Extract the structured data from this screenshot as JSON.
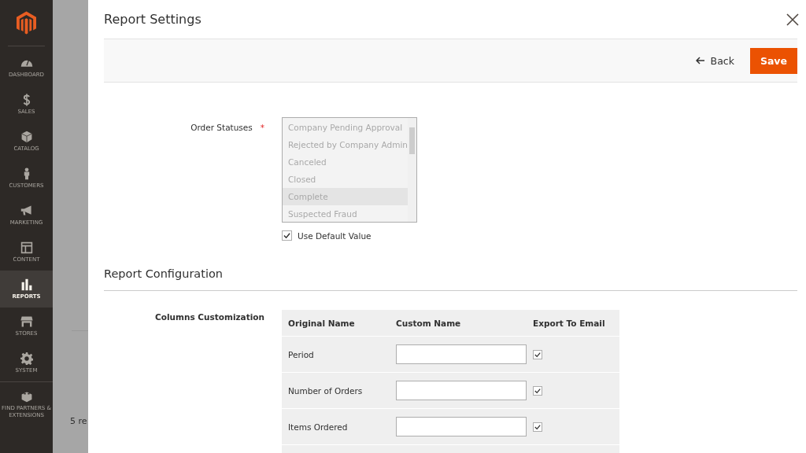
{
  "sidebar": {
    "items": [
      {
        "label": "DASHBOARD",
        "kind": "gauge",
        "selected": false
      },
      {
        "label": "SALES",
        "kind": "dollar",
        "selected": false
      },
      {
        "label": "CATALOG",
        "kind": "box",
        "selected": false
      },
      {
        "label": "CUSTOMERS",
        "kind": "person",
        "selected": false
      },
      {
        "label": "MARKETING",
        "kind": "megaphone",
        "selected": false
      },
      {
        "label": "CONTENT",
        "kind": "layout",
        "selected": false
      },
      {
        "label": "REPORTS",
        "kind": "bars",
        "selected": true
      },
      {
        "label": "STORES",
        "kind": "store",
        "selected": false
      },
      {
        "label": "SYSTEM",
        "kind": "gear",
        "selected": false
      },
      {
        "label": "FIND PARTNERS & EXTENSIONS",
        "kind": "brick",
        "selected": false
      }
    ]
  },
  "backdrop": {
    "text": "5 re"
  },
  "modal": {
    "title": "Report Settings",
    "back_button": "Back",
    "save_button": "Save",
    "order_statuses": {
      "label": "Order Statuses",
      "required_mark": "*",
      "disabled": true,
      "options": [
        {
          "label": "Company Pending Approval",
          "selected": false
        },
        {
          "label": "Rejected by Company Admin",
          "selected": false
        },
        {
          "label": "Canceled",
          "selected": false
        },
        {
          "label": "Closed",
          "selected": false
        },
        {
          "label": "Complete",
          "selected": true
        },
        {
          "label": "Suspected Fraud",
          "selected": false
        }
      ],
      "use_default": {
        "label": "Use Default Value",
        "checked": true
      }
    },
    "section_title": "Report Configuration",
    "columns_customization": {
      "label": "Columns Customization",
      "columns": [
        "Original Name",
        "Custom Name",
        "Export To Email"
      ],
      "rows": [
        {
          "original_name": "Period",
          "export": true
        },
        {
          "original_name": "Number of Orders",
          "export": true
        },
        {
          "original_name": "Items Ordered",
          "export": true
        }
      ]
    }
  }
}
